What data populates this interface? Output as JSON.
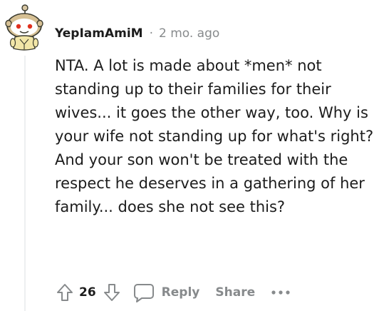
{
  "comment": {
    "author": "YepIamAmiM",
    "separator": "·",
    "timestamp": "2 mo. ago",
    "body": "NTA. A lot is made about *men* not standing up to their families for their wives... it goes the other way, too. Why is your wife not standing up for what's right? And your son won't be treated with the respect he deserves in a gathering of her family... does she not see this?",
    "avatar_icon": "snoo-avatar"
  },
  "actions": {
    "upvote_icon": "upvote-arrow-icon",
    "score": "26",
    "downvote_icon": "downvote-arrow-icon",
    "reply_icon": "comment-bubble-icon",
    "reply_label": "Reply",
    "share_label": "Share",
    "more_icon": "more-options-icon"
  },
  "colors": {
    "text": "#1c1c1c",
    "muted": "#878a8c",
    "thread_line": "#edeff1"
  }
}
